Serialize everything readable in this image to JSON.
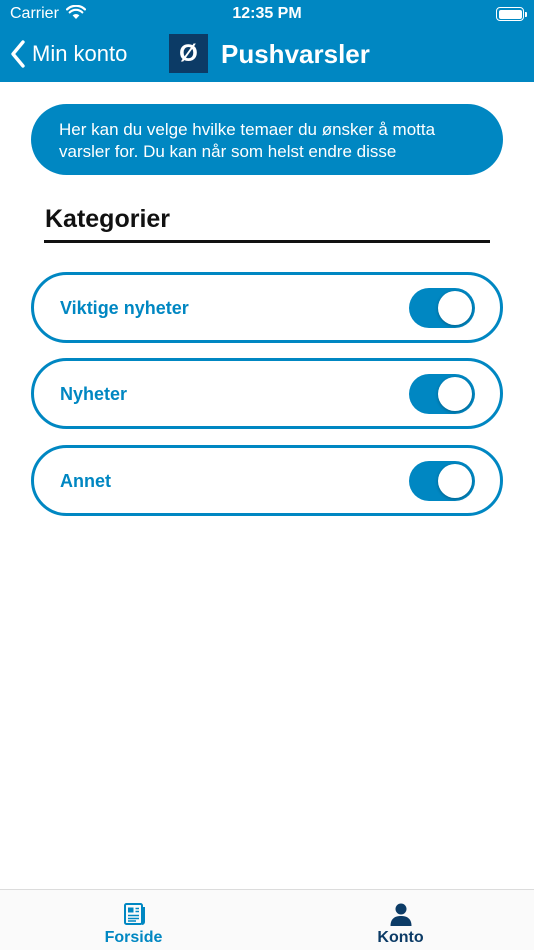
{
  "status_bar": {
    "carrier": "Carrier",
    "time": "12:35 PM"
  },
  "nav": {
    "back_label": "Min konto",
    "logo_letter": "Ø",
    "title": "Pushvarsler"
  },
  "info_text": "Her kan du velge hvilke temaer du ønsker å motta varsler for. Du kan når som helst endre disse",
  "section_title": "Kategorier",
  "categories": [
    {
      "label": "Viktige nyheter",
      "enabled": true
    },
    {
      "label": "Nyheter",
      "enabled": true
    },
    {
      "label": "Annet",
      "enabled": true
    }
  ],
  "tabs": [
    {
      "label": "Forside",
      "icon": "newspaper-icon",
      "active": false
    },
    {
      "label": "Konto",
      "icon": "person-icon",
      "active": true
    }
  ],
  "colors": {
    "brand": "#0087c2",
    "logo_bg": "#0c3b66",
    "tab_active": "#0c3b66",
    "tab_inactive": "#0087c2"
  }
}
